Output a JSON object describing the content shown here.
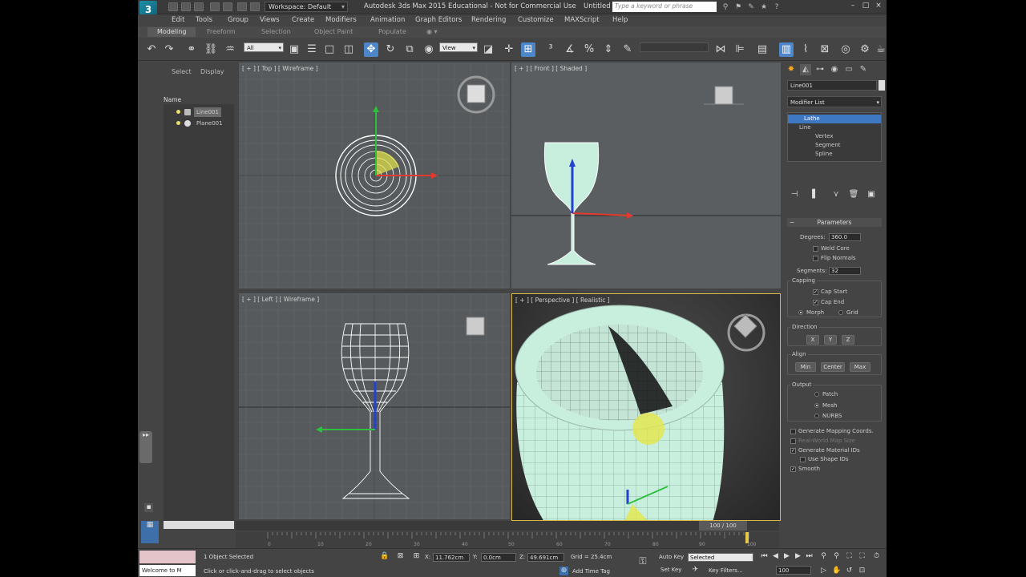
{
  "titlebar": {
    "workspace": "Workspace: Default",
    "title": "Autodesk 3ds Max  2015  Educational  -  Not for Commercial Use",
    "doc": "Untitled",
    "search_placeholder": "Type a keyword or phrase"
  },
  "menu": [
    "Edit",
    "Tools",
    "Group",
    "Views",
    "Create",
    "Modifiers",
    "Animation",
    "Graph Editors",
    "Rendering",
    "Customize",
    "MAXScript",
    "Help"
  ],
  "ribbon_tabs": [
    "Modeling",
    "Freeform",
    "Selection",
    "Object Paint",
    "Populate"
  ],
  "toolbar": {
    "filter": "All",
    "ref_coord": "View",
    "named_sel": ""
  },
  "explorer": {
    "tabs": [
      "Select",
      "Display"
    ],
    "header": "Name",
    "items": [
      {
        "name": "Line001",
        "selected": true
      },
      {
        "name": "Plane001",
        "selected": false
      }
    ]
  },
  "viewports": {
    "top": "[ + ] [ Top ] [ Wireframe ]",
    "front": "[ + ] [ Front ] [ Shaded ]",
    "left": "[ + ] [ Left ] [ Wireframe ]",
    "persp": "[ + ] [ Perspective ] [ Realistic ]"
  },
  "command_panel": {
    "object_name": "Line001",
    "modifier_list": "Modifier List",
    "stack": [
      {
        "label": "Lathe",
        "indent": 0,
        "selected": true
      },
      {
        "label": "Line",
        "indent": 0,
        "selected": false
      },
      {
        "label": "Vertex",
        "indent": 1,
        "selected": false
      },
      {
        "label": "Segment",
        "indent": 1,
        "selected": false
      },
      {
        "label": "Spline",
        "indent": 1,
        "selected": false
      }
    ],
    "parameters": {
      "title": "Parameters",
      "degrees_label": "Degrees:",
      "degrees": "360.0",
      "weld_core": "Weld Core",
      "flip_normals": "Flip Normals",
      "segments_label": "Segments:",
      "segments": "32",
      "capping": "Capping",
      "cap_start": "Cap Start",
      "cap_end": "Cap End",
      "morph": "Morph",
      "grid": "Grid",
      "direction": "Direction",
      "dir_buttons": [
        "X",
        "Y",
        "Z"
      ],
      "align": "Align",
      "align_buttons": [
        "Min",
        "Center",
        "Max"
      ],
      "output": "Output",
      "output_opts": [
        "Patch",
        "Mesh",
        "NURBS"
      ],
      "gen_mapping": "Generate Mapping Coords.",
      "real_world": "Real-World Map Size",
      "gen_material": "Generate Material IDs",
      "use_shape": "Use Shape IDs",
      "smooth": "Smooth"
    }
  },
  "timeline": {
    "frame": "100 / 100",
    "ticks": [
      "0",
      "10",
      "20",
      "30",
      "40",
      "50",
      "60",
      "70",
      "80",
      "90",
      "100"
    ]
  },
  "status": {
    "maxscript": "Welcome to M",
    "selected": "1 Object Selected",
    "prompt": "Click or click-and-drag to select objects",
    "x_label": "X:",
    "x": "11.762cm",
    "y_label": "Y:",
    "y": "0.0cm",
    "z_label": "Z:",
    "z": "49.691cm",
    "grid": "Grid = 25.4cm",
    "add_time_tag": "Add Time Tag",
    "auto_key": "Auto Key",
    "set_key": "Set Key",
    "selected_dd": "Selected",
    "key_filters": "Key Filters...",
    "frame_field": "100"
  },
  "colors": {
    "accent": "#4d86c9",
    "glass": "#c8eedd",
    "highlight": "#e6e64a"
  }
}
